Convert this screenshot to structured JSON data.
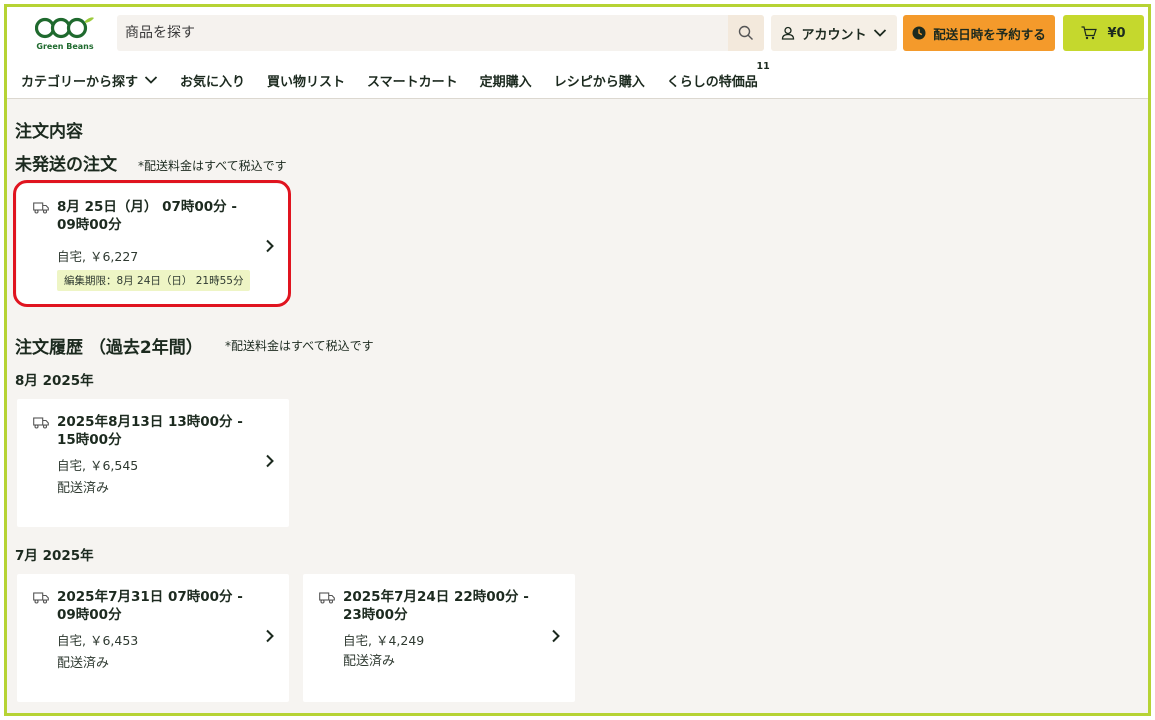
{
  "header": {
    "logo_text": "Green Beans",
    "search_placeholder": "商品を探す",
    "account_label": "アカウント",
    "reserve_label": "配送日時を予約する",
    "cart_label": "¥0"
  },
  "nav": {
    "items": [
      {
        "label": "カテゴリーから探す",
        "has_chevron": true
      },
      {
        "label": "お気に入り"
      },
      {
        "label": "買い物リスト"
      },
      {
        "label": "スマートカート"
      },
      {
        "label": "定期購入"
      },
      {
        "label": "レシピから購入"
      },
      {
        "label": "くらしの特価品",
        "badge": "11"
      }
    ]
  },
  "page": {
    "title": "注文内容",
    "pending": {
      "heading": "未発送の注文",
      "note": "*配送料金はすべて税込です",
      "order": {
        "title": "8月 25日（月） 07時00分 - 09時00分",
        "address_price": "自宅, ￥6,227",
        "edit_deadline": "編集期限：8月 24日（日） 21時55分"
      }
    },
    "history": {
      "heading": "注文履歴 （過去2年間）",
      "note": "*配送料金はすべて税込です",
      "groups": [
        {
          "month": "8月 2025年",
          "orders": [
            {
              "title": "2025年8月13日 13時00分 - 15時00分",
              "address_price": "自宅, ￥6,545",
              "status": "配送済み"
            }
          ]
        },
        {
          "month": "7月 2025年",
          "orders": [
            {
              "title": "2025年7月31日 07時00分 - 09時00分",
              "address_price": "自宅, ￥6,453",
              "status": "配送済み"
            },
            {
              "title": "2025年7月24日 22時00分 - 23時00分",
              "address_price": "自宅, ￥4,249",
              "status": "配送済み"
            }
          ]
        }
      ]
    }
  },
  "colors": {
    "frame_border": "#b6d334",
    "reserve_button": "#f49a2b",
    "cart_button": "#c5d82d",
    "highlight": "#e0141f",
    "logo_green": "#1f6a2e"
  }
}
